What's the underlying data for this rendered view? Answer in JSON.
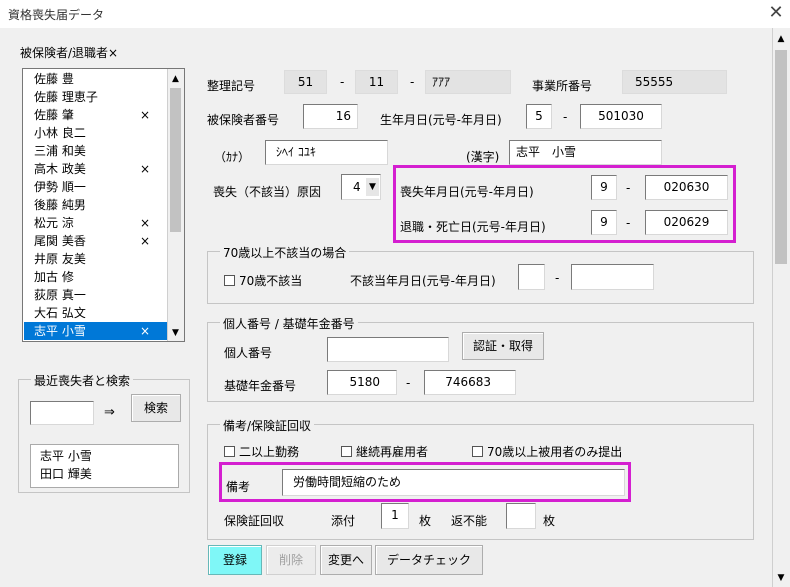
{
  "window": {
    "title": "資格喪失届データ",
    "close_glyph": "✕"
  },
  "left": {
    "list_title": "被保険者/退職者×",
    "members": [
      {
        "name": "佐藤 豊",
        "mark": ""
      },
      {
        "name": "佐藤 理恵子",
        "mark": ""
      },
      {
        "name": "佐藤 肇",
        "mark": "×"
      },
      {
        "name": "小林 良二",
        "mark": ""
      },
      {
        "name": "三浦 和美",
        "mark": ""
      },
      {
        "name": "高木 政美",
        "mark": "×"
      },
      {
        "name": "伊勢 順一",
        "mark": ""
      },
      {
        "name": "後藤 純男",
        "mark": ""
      },
      {
        "name": "松元 涼",
        "mark": "×"
      },
      {
        "name": "尾関 美香",
        "mark": "×"
      },
      {
        "name": "井原 友美",
        "mark": ""
      },
      {
        "name": "加古 修",
        "mark": ""
      },
      {
        "name": "荻原 真一",
        "mark": ""
      },
      {
        "name": "大石 弘文",
        "mark": ""
      },
      {
        "name": "志平 小雪",
        "mark": "×"
      }
    ],
    "selected_index": 14,
    "recent": {
      "group_title": "最近喪失者と検索",
      "search_value": "",
      "arrow": "⇒",
      "search_button": "検索",
      "results": [
        "志平 小雪",
        "田口 輝美"
      ]
    }
  },
  "form": {
    "seiri_label": "整理記号",
    "seiri_1": "51",
    "seiri_2": "11",
    "seiri_3": "ｱｱｱ",
    "office_label": "事業所番号",
    "office_value": "55555",
    "insured_no_label": "被保険者番号",
    "insured_no": "16",
    "birth_label": "生年月日(元号-年月日)",
    "birth_era": "5",
    "birth_date": "501030",
    "kana_label": "（ｶﾅ）",
    "kana_value": "ｼﾍｲ ｺﾕｷ",
    "kanji_label": "(漢字)",
    "kanji_value": "志平　小雪",
    "loss_reason_label": "喪失（不該当）原因",
    "loss_reason_value": "4",
    "loss_date_label": "喪失年月日(元号-年月日)",
    "loss_era": "9",
    "loss_date": "020630",
    "retire_label": "退職・死亡日(元号-年月日)",
    "retire_era": "9",
    "retire_date": "020629",
    "dash": "-"
  },
  "over70": {
    "group_title": "70歳以上不該当の場合",
    "checkbox_label": "70歳不該当",
    "date_label": "不該当年月日(元号-年月日)",
    "era": "",
    "date": ""
  },
  "mynumber": {
    "group_title": "個人番号 / 基礎年金番号",
    "personal_label": "個人番号",
    "personal_value": "",
    "auth_button": "認証・取得",
    "pension_label": "基礎年金番号",
    "pension_1": "5180",
    "pension_2": "746683"
  },
  "remarks": {
    "group_title": "備考/保険証回収",
    "cb1": "二以上勤務",
    "cb2": "継続再雇用者",
    "cb3": "70歳以上被用者のみ提出",
    "remark_label": "備考",
    "remark_value": "労働時間短縮のため",
    "card_label": "保険証回収",
    "attached_label": "添付",
    "attached_value": "1",
    "unit1": "枚",
    "unreturnable_label": "返不能",
    "unreturnable_value": "",
    "unit2": "枚"
  },
  "buttons": {
    "register": "登録",
    "delete": "削除",
    "change": "変更へ",
    "check": "データチェック"
  },
  "colors": {
    "highlight": "#d41fd0",
    "selection": "#0078d7",
    "register_bg": "#7ff7f7"
  }
}
